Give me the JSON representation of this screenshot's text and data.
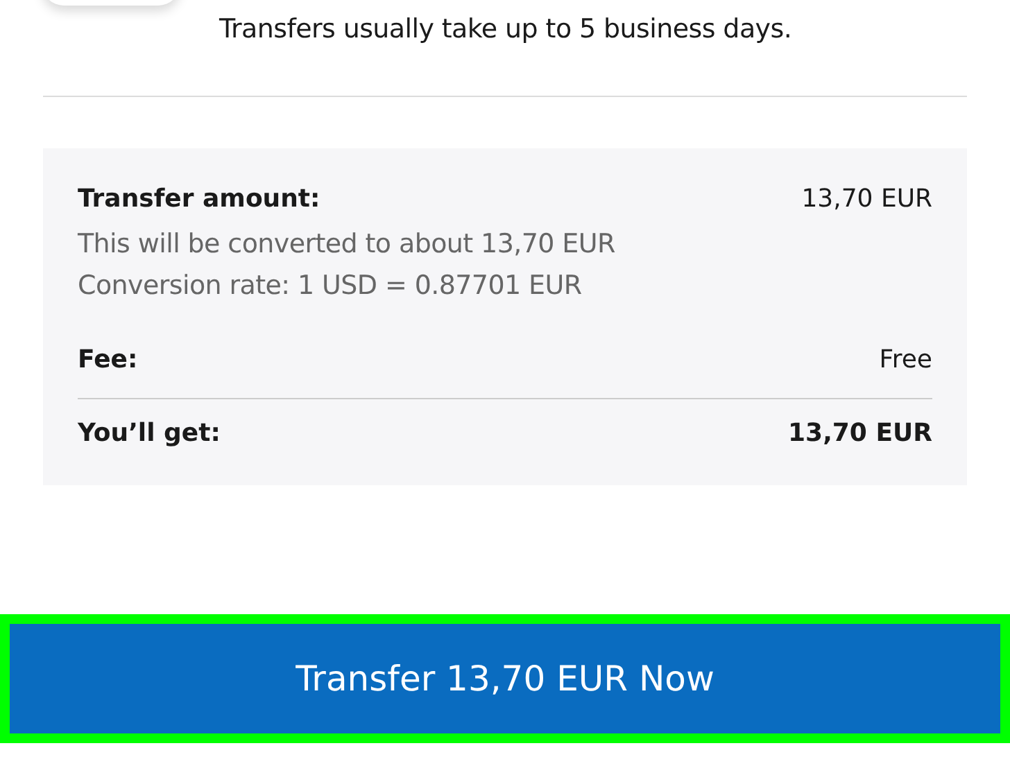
{
  "notice": "Transfers usually take up to 5 business days.",
  "summary": {
    "rows": [
      {
        "kind": "main",
        "label": "Transfer amount:",
        "value": "13,70 EUR",
        "notes": [
          "This will be converted to about 13,70 EUR",
          "Conversion rate: 1 USD = 0.87701 EUR"
        ]
      },
      {
        "kind": "main",
        "label": "Fee:",
        "value": "Free"
      },
      {
        "kind": "total",
        "label": "You’ll get:",
        "value": "13,70 EUR"
      }
    ]
  },
  "button": {
    "label": "Transfer 13,70 EUR Now",
    "highlighted": true
  }
}
